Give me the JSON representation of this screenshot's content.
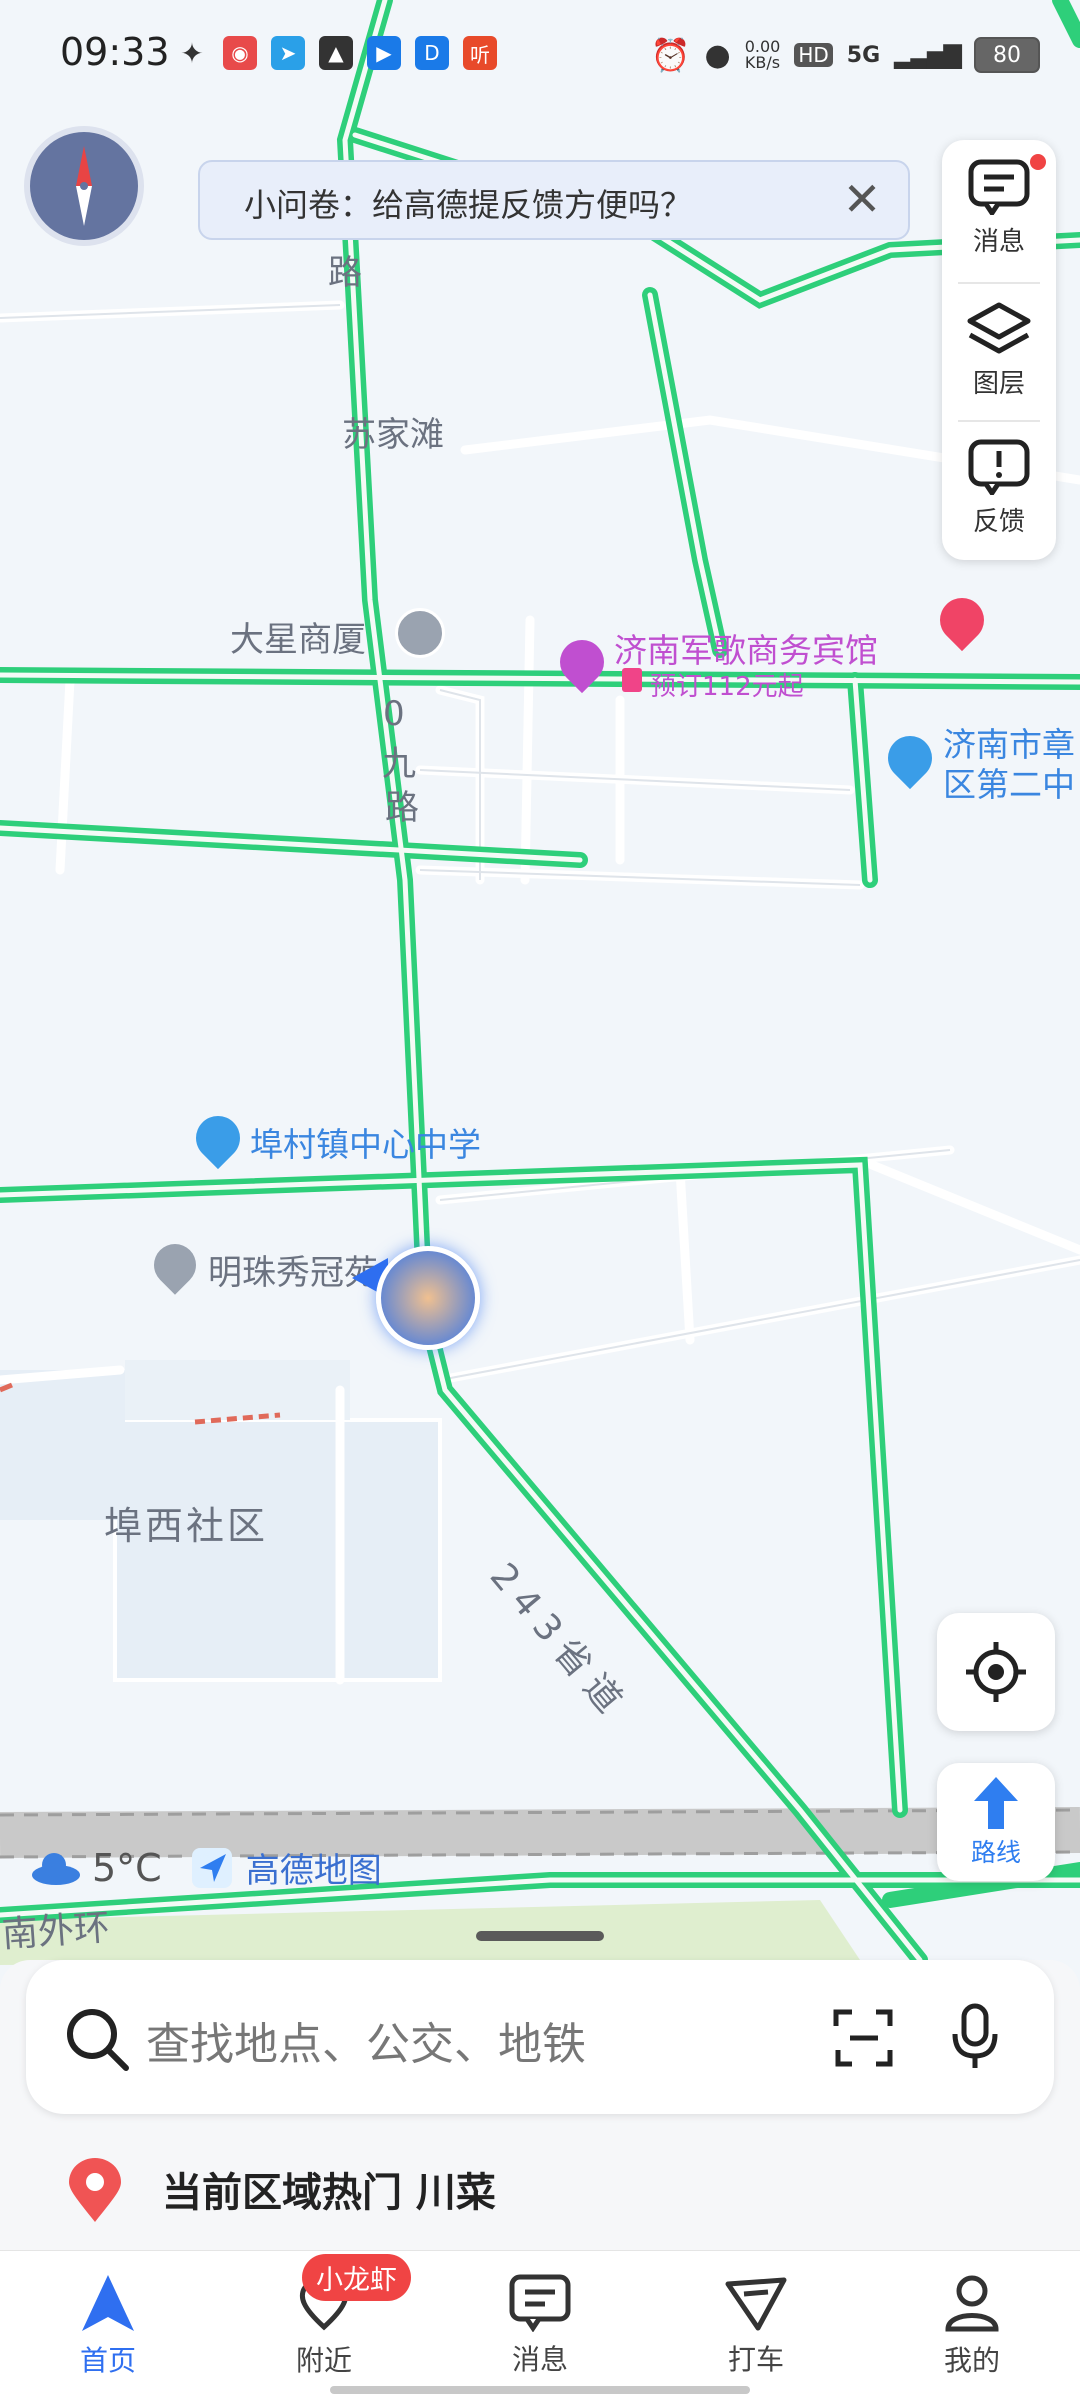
{
  "status_bar": {
    "time": "09:33",
    "net_speed": "0.00",
    "net_unit": "KB/s",
    "hd": "HD",
    "signal": "5G",
    "battery": "80"
  },
  "survey": {
    "text": "小问卷：给高德提反馈方便吗？"
  },
  "toolbox": {
    "items": [
      {
        "label": "消息"
      },
      {
        "label": "图层"
      },
      {
        "label": "反馈"
      }
    ]
  },
  "map": {
    "place_labels": [
      "路",
      "苏家滩",
      "大星商厦",
      "0",
      "九",
      "路",
      "埠西社区",
      "南外环"
    ],
    "road_label": "243省道",
    "poi": {
      "hotel": "济南军歌商务宾馆",
      "hotel_price": "预订112元起",
      "school_right_1": "济南市章",
      "school_right_2": "区第二中",
      "school_center": "埠村镇中心中学",
      "residence": "明珠秀冠苑"
    }
  },
  "weather": {
    "temp": "5°C",
    "brand": "高德地图"
  },
  "route_button": {
    "label": "路线"
  },
  "search": {
    "placeholder": "查找地点、公交、地铁"
  },
  "hot": {
    "text": "当前区域热门  川菜"
  },
  "tabs": [
    {
      "label": "首页",
      "active": true
    },
    {
      "label": "附近"
    },
    {
      "label": "消息"
    },
    {
      "label": "打车"
    },
    {
      "label": "我的"
    }
  ],
  "nearby_badge": "小龙虾",
  "colors": {
    "road": "#2ecf7a",
    "accent": "#2f6ff0",
    "badge": "#f04444"
  }
}
